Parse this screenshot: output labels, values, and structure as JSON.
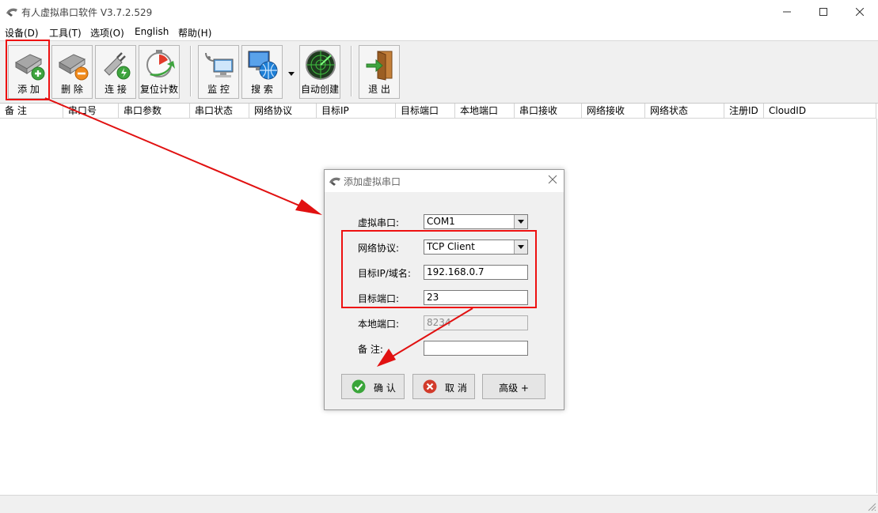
{
  "window": {
    "title": "有人虚拟串口软件 V3.7.2.529"
  },
  "menu": [
    "设备(D)",
    "工具(T)",
    "选项(O)",
    "English",
    "帮助(H)"
  ],
  "toolbar": {
    "add": "添 加",
    "delete": "删 除",
    "connect": "连 接",
    "reset": "复位计数",
    "monitor": "监 控",
    "search": "搜 索",
    "auto": "自动创建",
    "exit": "退 出"
  },
  "table": {
    "columns": [
      "备 注",
      "串口号",
      "串口参数",
      "串口状态",
      "网络协议",
      "目标IP",
      "目标端口",
      "本地端口",
      "串口接收",
      "网络接收",
      "网络状态",
      "注册ID",
      "CloudID"
    ]
  },
  "dialog": {
    "title": "添加虚拟串口",
    "virtual_port_label": "虚拟串口:",
    "virtual_port_value": "COM1",
    "protocol_label": "网络协议:",
    "protocol_value": "TCP Client",
    "target_ip_label": "目标IP/域名:",
    "target_ip_value": "192.168.0.7",
    "target_port_label": "目标端口:",
    "target_port_value": "23",
    "local_port_label": "本地端口:",
    "local_port_value": "8234",
    "remark_label": "备 注:",
    "remark_value": "",
    "ok": "确 认",
    "cancel": "取 消",
    "advanced": "高级 +"
  },
  "colors": {
    "annotation": "#e11111",
    "ok_green": "#3aa53a",
    "cancel_red": "#d23b2b"
  }
}
